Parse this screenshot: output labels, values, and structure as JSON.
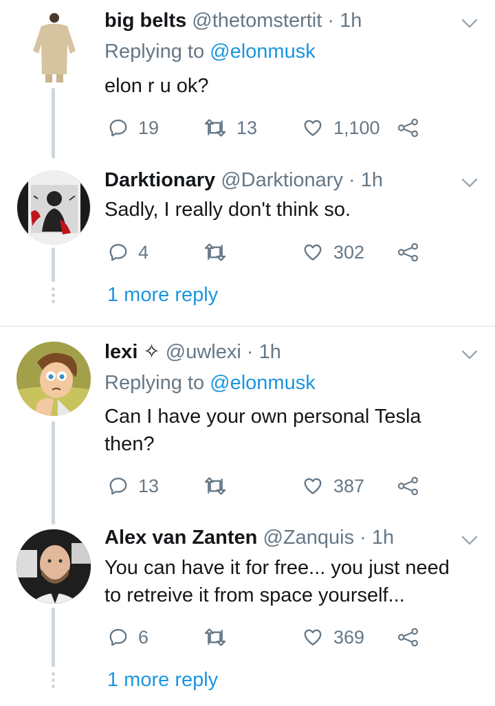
{
  "tweets": [
    {
      "name": "big belts",
      "handle": "@thetomstertit",
      "sep": " · ",
      "time": "1h",
      "replying_prefix": "Replying to ",
      "replying_handle": "@elonmusk",
      "text": "elon r u ok?",
      "replies": "19",
      "retweets": "13",
      "likes": "1,100"
    },
    {
      "name": "Darktionary",
      "handle": "@Darktionary",
      "sep": " · ",
      "time": "1h",
      "text": "Sadly, I really don't think so.",
      "replies": "4",
      "retweets": "",
      "likes": "302",
      "more_replies": "1 more reply"
    },
    {
      "name": "lexi ✧",
      "handle": "@uwlexi",
      "sep": " · ",
      "time": "1h",
      "replying_prefix": "Replying to ",
      "replying_handle": "@elonmusk",
      "text_line1": "Can I have your own personal Tesla",
      "text_line2": "then?",
      "replies": "13",
      "retweets": "",
      "likes": "387"
    },
    {
      "name": "Alex van Zanten",
      "handle": "@Zanquis",
      "sep": " · ",
      "time": "1h",
      "text_line1": "You can have it for free... you just need",
      "text_line2": "to retreive it from space yourself...",
      "replies": "6",
      "retweets": "",
      "likes": "369",
      "more_replies": "1 more reply"
    }
  ],
  "icons": {
    "reply": "reply-icon",
    "retweet": "retweet-icon",
    "like": "heart-icon",
    "share": "share-icon",
    "menu": "chevron-down-icon"
  },
  "colors": {
    "link": "#1b95e0",
    "muted": "#657786",
    "thread_line": "#ccd6dd"
  }
}
